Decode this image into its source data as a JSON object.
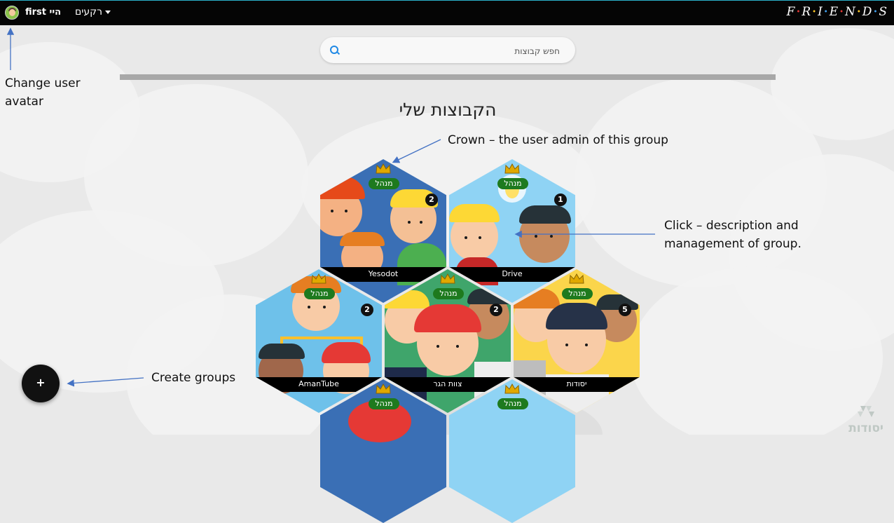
{
  "topbar": {
    "greeting": "first היי",
    "backgrounds_menu": "רקעים",
    "logo": [
      "F",
      "R",
      "I",
      "E",
      "N",
      "D",
      "S"
    ]
  },
  "search": {
    "placeholder": "חפש קבוצות"
  },
  "page_title": "הקבוצות שלי",
  "admin_badge": "מנהל",
  "groups": [
    {
      "name": "Yesodot",
      "count": "2",
      "admin": true
    },
    {
      "name": "Drive",
      "count": "1",
      "admin": true
    },
    {
      "name": "AmanTube",
      "count": "2",
      "admin": true
    },
    {
      "name": "צוות הגר",
      "count": "2",
      "admin": true
    },
    {
      "name": "יסודות",
      "count": "5",
      "admin": true
    },
    {
      "name": "",
      "count": "",
      "admin": true
    },
    {
      "name": "",
      "count": "",
      "admin": true
    }
  ],
  "annotations": {
    "avatar": "Change user avatar",
    "crown": "Crown – the user admin of this group",
    "click": "Click – description and management of group.",
    "create": "Create groups"
  },
  "fab": {
    "label": "+"
  },
  "watermark": "יסודות",
  "colors": {
    "admin_badge": "#1e7a1e",
    "search_icon": "#1e88e5",
    "arrow": "#4472c4"
  }
}
